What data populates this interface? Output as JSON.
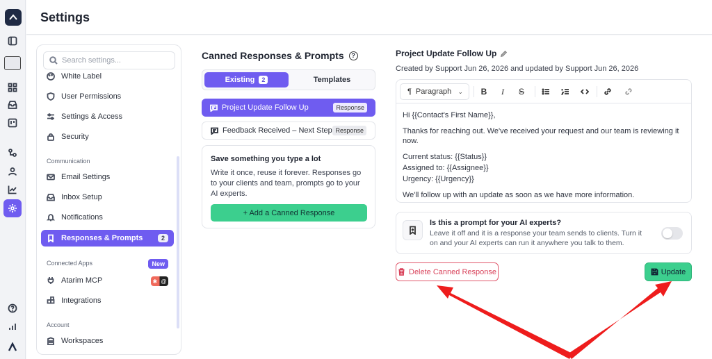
{
  "header": {
    "title": "Settings"
  },
  "sidebar": {
    "search_placeholder": "Search settings...",
    "items": [
      {
        "label": "White Label",
        "icon": "palette-icon"
      },
      {
        "label": "User Permissions",
        "icon": "shield-icon"
      },
      {
        "label": "Settings & Access",
        "icon": "sliders-icon"
      },
      {
        "label": "Security",
        "icon": "lock-icon"
      },
      {
        "label": "Email Settings",
        "icon": "mail-icon"
      },
      {
        "label": "Inbox Setup",
        "icon": "inbox-icon"
      },
      {
        "label": "Notifications",
        "icon": "bell-icon"
      },
      {
        "label": "Responses & Prompts",
        "icon": "bookmark-icon",
        "count": "2"
      },
      {
        "label": "Atarim MCP",
        "icon": "plug-icon"
      },
      {
        "label": "Integrations",
        "icon": "puzzle-icon"
      },
      {
        "label": "Workspaces",
        "icon": "building-icon"
      }
    ],
    "sections": {
      "communication": "Communication",
      "connected_apps": "Connected Apps",
      "account": "Account"
    },
    "new_badge": "New"
  },
  "canned": {
    "title": "Canned Responses & Prompts",
    "tabs": {
      "existing": "Existing",
      "existing_count": "2",
      "templates": "Templates"
    },
    "responses": [
      {
        "label": "Project Update Follow Up",
        "tag": "Response"
      },
      {
        "label": "Feedback Received – Next Steps",
        "tag": "Response"
      }
    ],
    "tip": {
      "title": "Save something you type a lot",
      "desc": "Write it once, reuse it forever. Responses go to your clients and team, prompts go to your AI experts.",
      "add_label": "+ Add a Canned Response"
    }
  },
  "editor": {
    "title": "Project Update Follow Up",
    "meta": "Created by Support Jun 26, 2026 and updated by Support Jun 26, 2026",
    "paragraph_select": "Paragraph",
    "body": {
      "greeting": "Hi {{Contact's First Name}},",
      "line1": "Thanks for reaching out. We've received your request and our team is reviewing it now.",
      "status": "Current status: {{Status}}",
      "assigned": "Assigned to: {{Assignee}}",
      "urgency": "Urgency: {{Urgency}}",
      "closing": "We'll follow up with an update as soon as we have more information."
    },
    "prompt": {
      "title": "Is this a prompt for your AI experts?",
      "desc": "Leave it off and it is a response your team sends to clients. Turn it on and your AI experts can run it anywhere you talk to them.",
      "enabled": false
    },
    "delete_label": "Delete Canned Response",
    "update_label": "Update"
  },
  "colors": {
    "accent": "#6f5cf0",
    "success": "#3ccf8e",
    "danger": "#d9445c",
    "arrow": "#ee1c1c"
  }
}
